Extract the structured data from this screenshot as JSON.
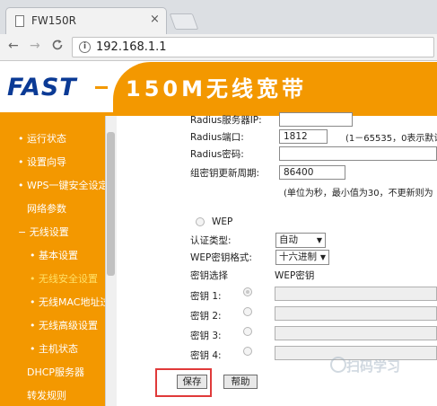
{
  "browser": {
    "tab_title": "FW150R",
    "tab_close": "×",
    "url": "192.168.1.1",
    "info_glyph": "i",
    "back_glyph": "←",
    "forward_glyph": "→",
    "reload_glyph": "C"
  },
  "router": {
    "logo": "FAST",
    "header_title": "150M无线宽带",
    "sidebar": [
      {
        "label": "• 运行状态"
      },
      {
        "label": "• 设置向导"
      },
      {
        "label": "• WPS一键安全设定"
      },
      {
        "label": "网络参数"
      },
      {
        "label": "− 无线设置"
      },
      {
        "label": "• 基本设置"
      },
      {
        "label": "• 无线安全设置"
      },
      {
        "label": "• 无线MAC地址过滤"
      },
      {
        "label": "• 无线高级设置"
      },
      {
        "label": "• 主机状态"
      },
      {
        "label": "DHCP服务器"
      },
      {
        "label": "转发规则"
      }
    ],
    "form": {
      "radius_server_ip_label": "Radius服务器IP:",
      "radius_port_label": "Radius端口:",
      "radius_port_value": "1812",
      "radius_port_hint": "(1－65535，0表示默认",
      "radius_password_label": "Radius密码:",
      "group_key_period_label": "组密钥更新周期:",
      "group_key_period_value": "86400",
      "group_key_period_hint": "(单位为秒，最小值为30，不更新则为",
      "wep_label": "WEP",
      "auth_type_label": "认证类型:",
      "auth_type_value": "自动",
      "wep_format_label": "WEP密钥格式:",
      "wep_format_value": "十六进制",
      "key_select_label": "密钥选择",
      "wep_key_header": "WEP密钥",
      "keys": [
        {
          "label": "密钥 1:"
        },
        {
          "label": "密钥 2:"
        },
        {
          "label": "密钥 3:"
        },
        {
          "label": "密钥 4:"
        }
      ],
      "save_label": "保存",
      "help_label": "帮助",
      "dropdown_arrow": "▼"
    },
    "watermark": "扫码学习"
  },
  "colors": {
    "brand_orange": "#f39800",
    "logo_blue": "#0b3a95",
    "highlight_red": "#e03a3a"
  }
}
